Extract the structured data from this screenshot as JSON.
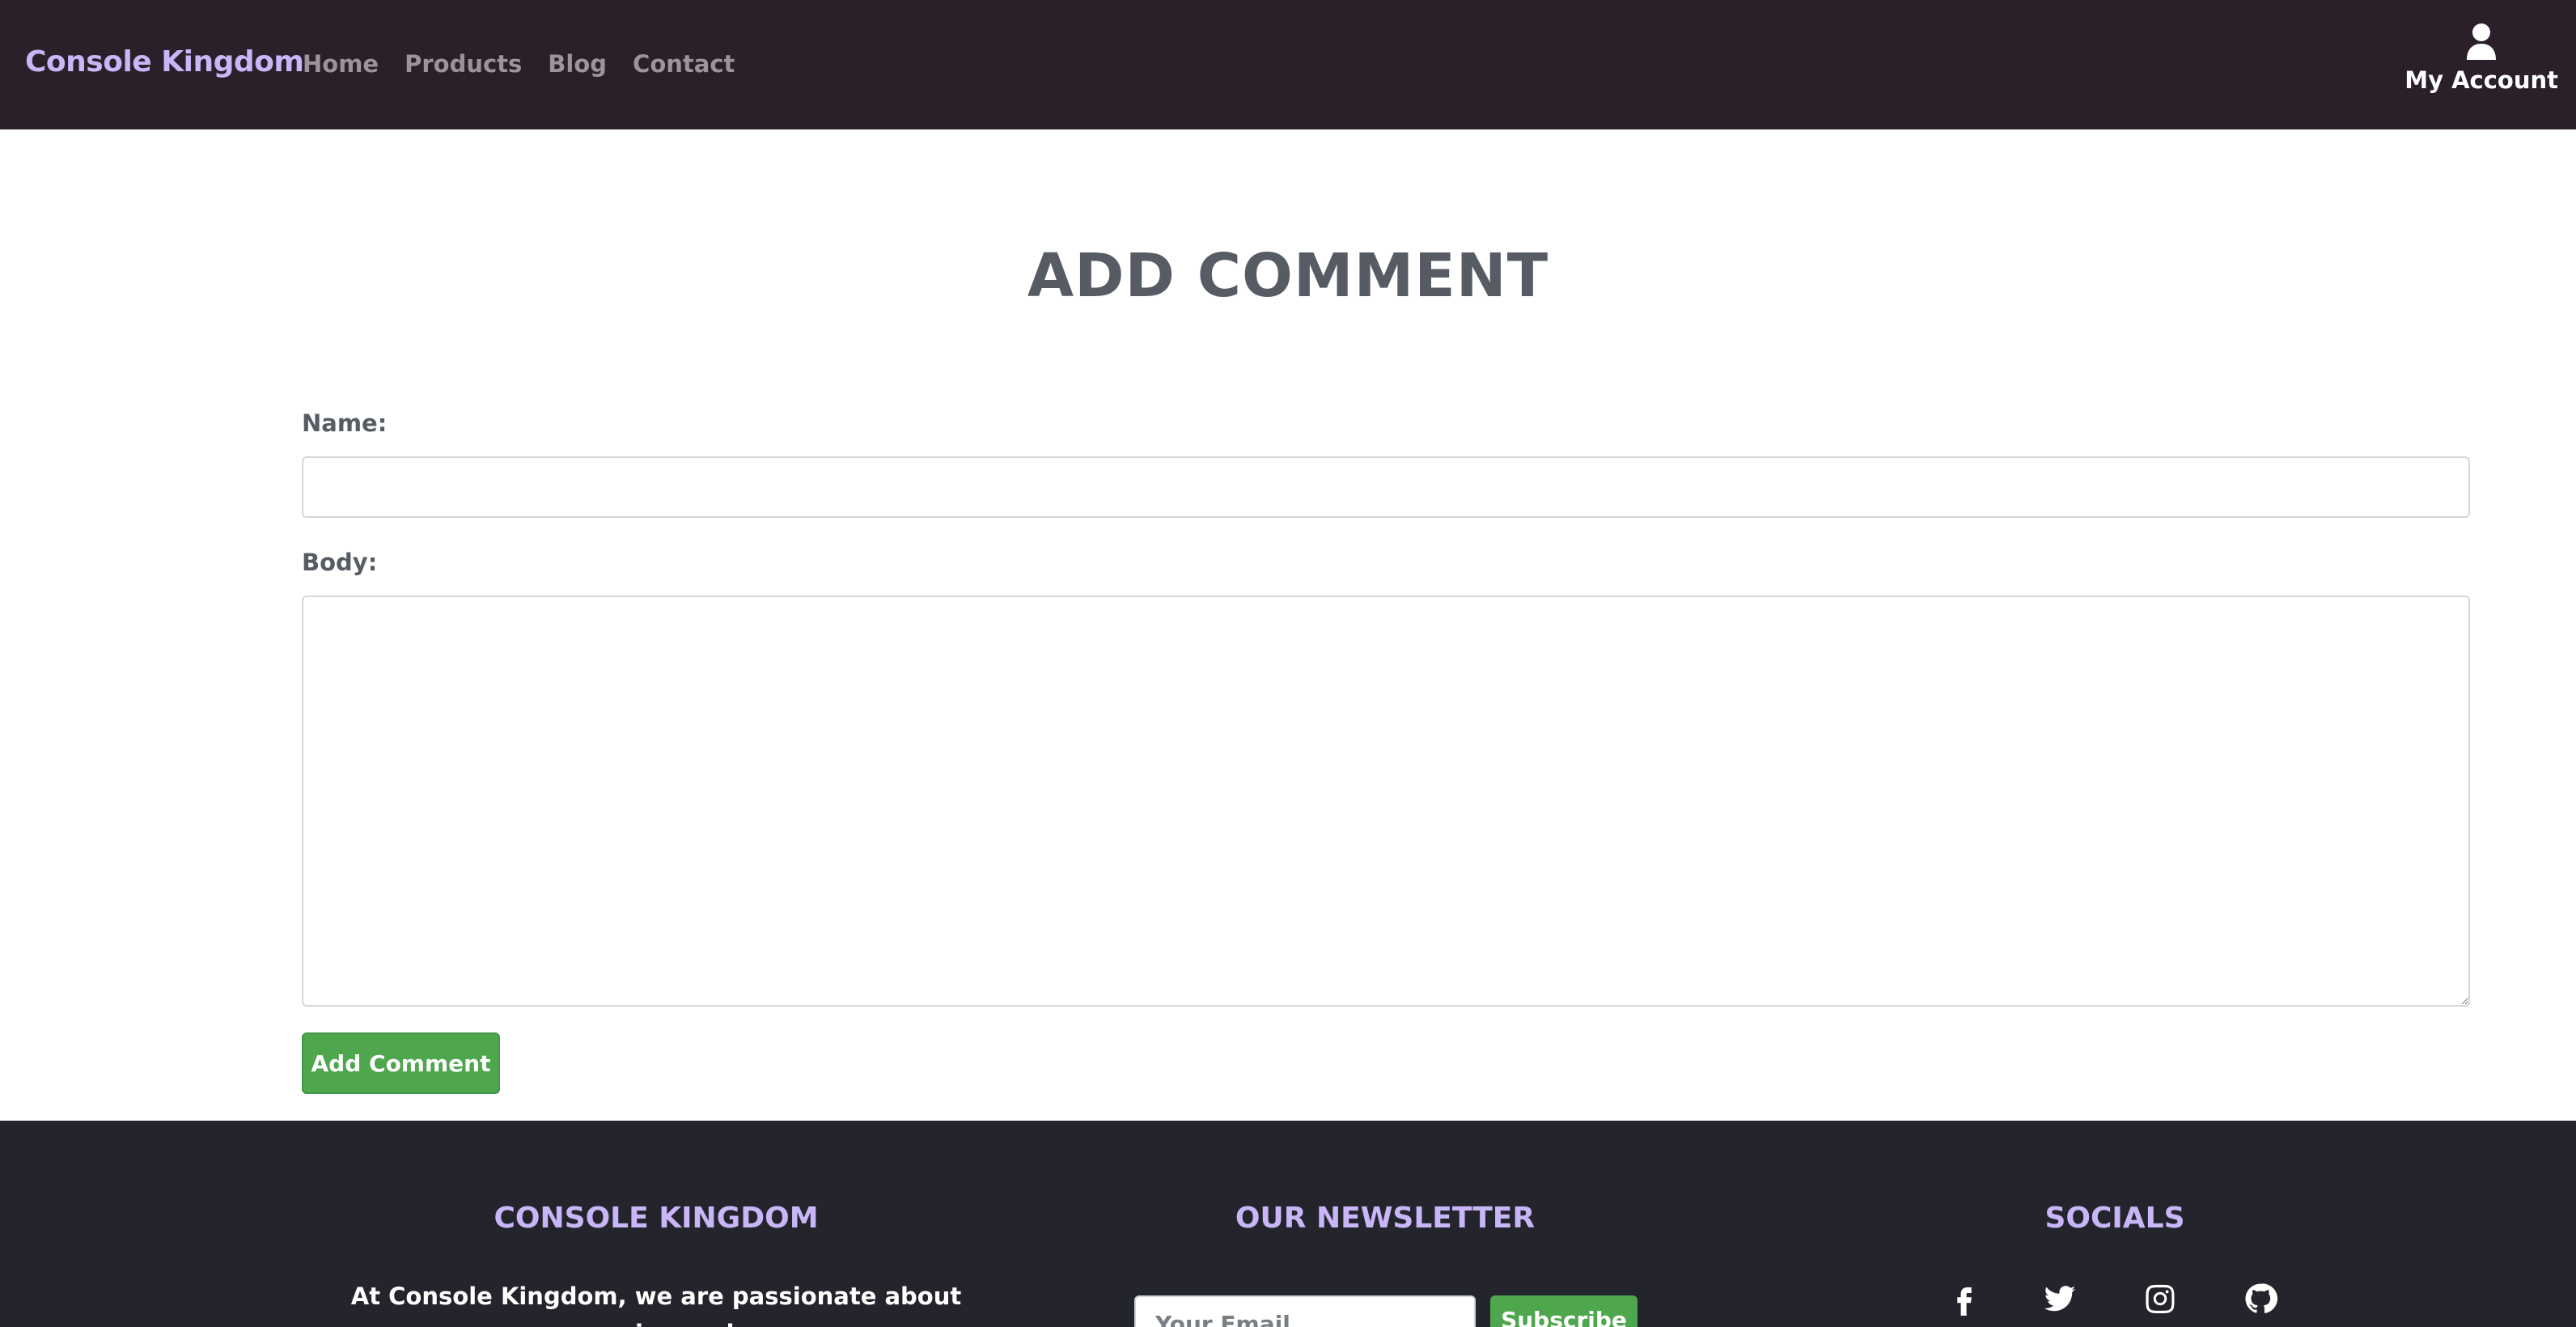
{
  "navbar": {
    "brand": "Console Kingdom",
    "links": [
      "Home",
      "Products",
      "Blog",
      "Contact"
    ],
    "account_label": "My Account",
    "account_icon": "user-icon"
  },
  "form": {
    "title": "ADD COMMENT",
    "name_label": "Name:",
    "name_value": "",
    "body_label": "Body:",
    "body_value": "",
    "submit_label": "Add Comment"
  },
  "footer": {
    "about_heading": "CONSOLE KINGDOM",
    "about_text": "At Console Kingdom, we are passionate about gaming and",
    "newsletter_heading": "OUR NEWSLETTER",
    "email_placeholder": "Your Email",
    "subscribe_label": "Subscribe",
    "socials_heading": "SOCIALS",
    "social_icons": [
      "facebook-icon",
      "twitter-icon",
      "instagram-icon",
      "github-icon"
    ]
  },
  "colors": {
    "navbar_bg": "#2b2029",
    "brand": "#c8b6f8",
    "heading_text": "#575c64",
    "button_green": "#4ea64d",
    "footer_bg": "#24252c"
  }
}
